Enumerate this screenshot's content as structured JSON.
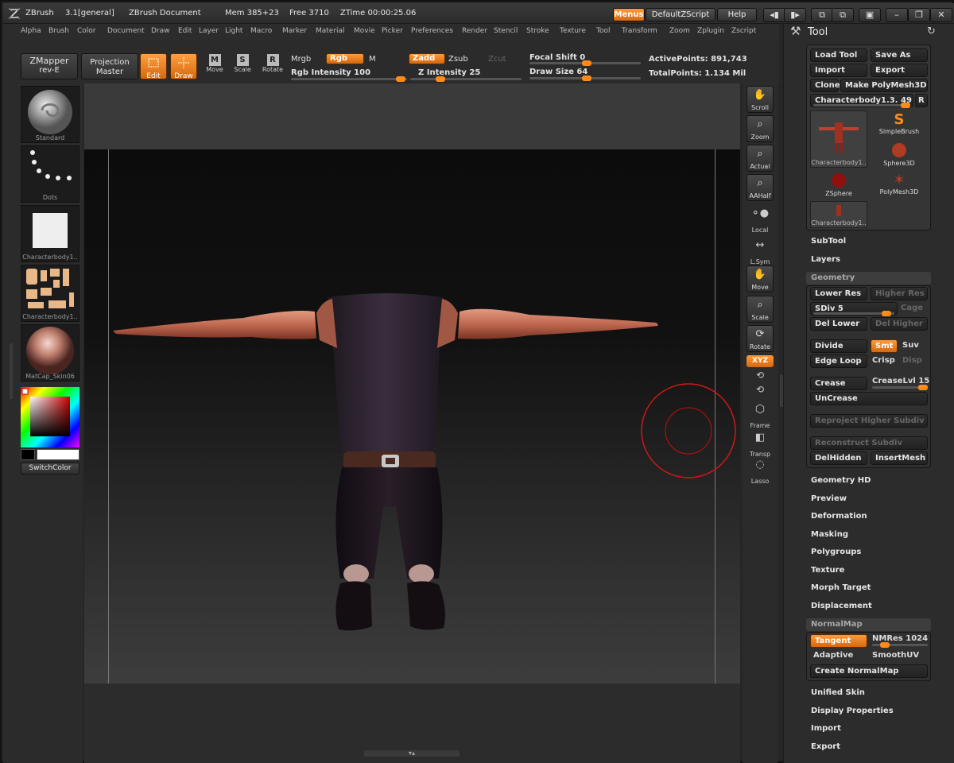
{
  "titlebar": {
    "app": "ZBrush",
    "version": "3.1[general]",
    "document": "ZBrush Document",
    "mem": "Mem 385+23",
    "free": "Free 3710",
    "ztime": "ZTime 00:00:25.06",
    "menus_btn": "Menus",
    "script_btn": "DefaultZScript",
    "help_btn": "Help"
  },
  "menubar": [
    "Alpha",
    "Brush",
    "Color",
    "Document",
    "Draw",
    "Edit",
    "Layer",
    "Light",
    "Macro",
    "Marker",
    "Material",
    "Movie",
    "Picker",
    "Preferences",
    "Render",
    "Stencil",
    "Stroke",
    "Texture",
    "Tool",
    "Transform",
    "Zoom",
    "Zplugin",
    "Zscript"
  ],
  "shelf": {
    "zmapper": "ZMapper",
    "zmapper_sub": "rev-E",
    "projection": "Projection",
    "projection_sub": "Master",
    "edit": "Edit",
    "draw": "Draw",
    "move": "Move",
    "scale": "Scale",
    "rotate": "Rotate",
    "mrgb": "Mrgb",
    "rgb": "Rgb",
    "m": "M",
    "rgb_intensity": "Rgb Intensity 100",
    "zadd": "Zadd",
    "zsub": "Zsub",
    "zcut": "Zcut",
    "z_intensity": "Z Intensity 25",
    "focal_shift": "Focal Shift 0",
    "draw_size": "Draw Size 64",
    "active_points": "ActivePoints: 891,743",
    "total_points": "TotalPoints: 1.134 Mil"
  },
  "left_tray": {
    "brush": "Standard",
    "stroke": "Dots",
    "alpha": "Characterbody1..",
    "texture": "Characterbody1..",
    "material": "MatCap_Skin06",
    "switch_color": "SwitchColor"
  },
  "right_shelf": [
    "Scroll",
    "Zoom",
    "Actual",
    "AAHalf",
    "Local",
    "L.Sym",
    "Move",
    "Scale",
    "Rotate",
    "XYZ",
    "Frame",
    "Transp",
    "Lasso"
  ],
  "tool_palette": {
    "title": "Tool",
    "load_tool": "Load Tool",
    "save_as": "Save As",
    "import": "Import",
    "export": "Export",
    "clone": "Clone",
    "make_polymesh": "Make PolyMesh3D",
    "current_tool": "Characterbody1.3. 49",
    "r": "R",
    "tools": [
      "Characterbody1..",
      "SimpleBrush",
      "Sphere3D",
      "ZSphere",
      "PolyMesh3D",
      "Characterbody1.."
    ],
    "subtool": "SubTool",
    "layers": "Layers",
    "geometry": {
      "header": "Geometry",
      "lower_res": "Lower Res",
      "higher_res": "Higher Res",
      "sdiv": "SDiv 5",
      "cage": "Cage",
      "del_lower": "Del Lower",
      "del_higher": "Del Higher",
      "divide": "Divide",
      "smt": "Smt",
      "suv": "Suv",
      "edge_loop": "Edge Loop",
      "crisp": "Crisp",
      "disp": "Disp",
      "crease": "Crease",
      "crease_lvl": "CreaseLvl 15",
      "uncrease": "UnCrease",
      "reproject": "Reproject Higher Subdiv",
      "reconstruct": "Reconstruct Subdiv",
      "delhidden": "DelHidden",
      "insertmesh": "InsertMesh"
    },
    "sections_a": [
      "Geometry HD",
      "Preview",
      "Deformation",
      "Masking",
      "Polygroups",
      "Texture",
      "Morph Target",
      "Displacement"
    ],
    "normalmap": {
      "header": "NormalMap",
      "tangent": "Tangent",
      "nmres": "NMRes 1024",
      "adaptive": "Adaptive",
      "smoothuv": "SmoothUV",
      "create": "Create NormalMap"
    },
    "sections_b": [
      "Unified Skin",
      "Display Properties",
      "Import",
      "Export"
    ]
  }
}
